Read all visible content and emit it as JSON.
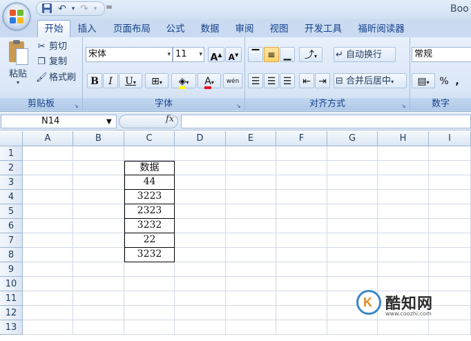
{
  "app": {
    "title": "Boo",
    "qat_more": "="
  },
  "tabs": [
    "开始",
    "插入",
    "页面布局",
    "公式",
    "数据",
    "审阅",
    "视图",
    "开发工具",
    "福昕阅读器"
  ],
  "ribbon": {
    "clipboard": {
      "paste": "粘贴",
      "cut": "剪切",
      "copy": "复制",
      "format_painter": "格式刷",
      "label": "剪贴板"
    },
    "font": {
      "name": "宋体",
      "size": "11",
      "grow": "A",
      "shrink": "A",
      "bold": "B",
      "italic": "I",
      "underline": "U",
      "font_color": "A",
      "phonetic": "wén",
      "label": "字体"
    },
    "alignment": {
      "wrap_text": "自动换行",
      "merge_center": "合并后居中",
      "label": "对齐方式"
    },
    "number": {
      "format": "常规",
      "percent": "%",
      "comma": ",",
      "label": "数字"
    }
  },
  "formula_bar": {
    "name_box": "N14",
    "fx": "fx",
    "value": ""
  },
  "sheet": {
    "columns": [
      "A",
      "B",
      "C",
      "D",
      "E",
      "F",
      "G",
      "H",
      "I"
    ],
    "rows": [
      "1",
      "2",
      "3",
      "4",
      "5",
      "6",
      "7",
      "8",
      "9",
      "10",
      "11",
      "12",
      "13"
    ],
    "data_column": "C",
    "data_cells": [
      {
        "row": "2",
        "value": "数据"
      },
      {
        "row": "3",
        "value": "44"
      },
      {
        "row": "4",
        "value": "3223"
      },
      {
        "row": "5",
        "value": "2323"
      },
      {
        "row": "6",
        "value": "3232"
      },
      {
        "row": "7",
        "value": "22"
      },
      {
        "row": "8",
        "value": "3232"
      }
    ]
  },
  "watermark": {
    "name": "酷知网",
    "url": "www.coozhi.com"
  },
  "colors": {
    "ribbon": "#dbe7f7",
    "tab_text": "#15428b",
    "header_fill": "#dbe6f4",
    "gridline": "#d0d7e5",
    "data_border": "#000000",
    "highlight": "#ffd166"
  }
}
